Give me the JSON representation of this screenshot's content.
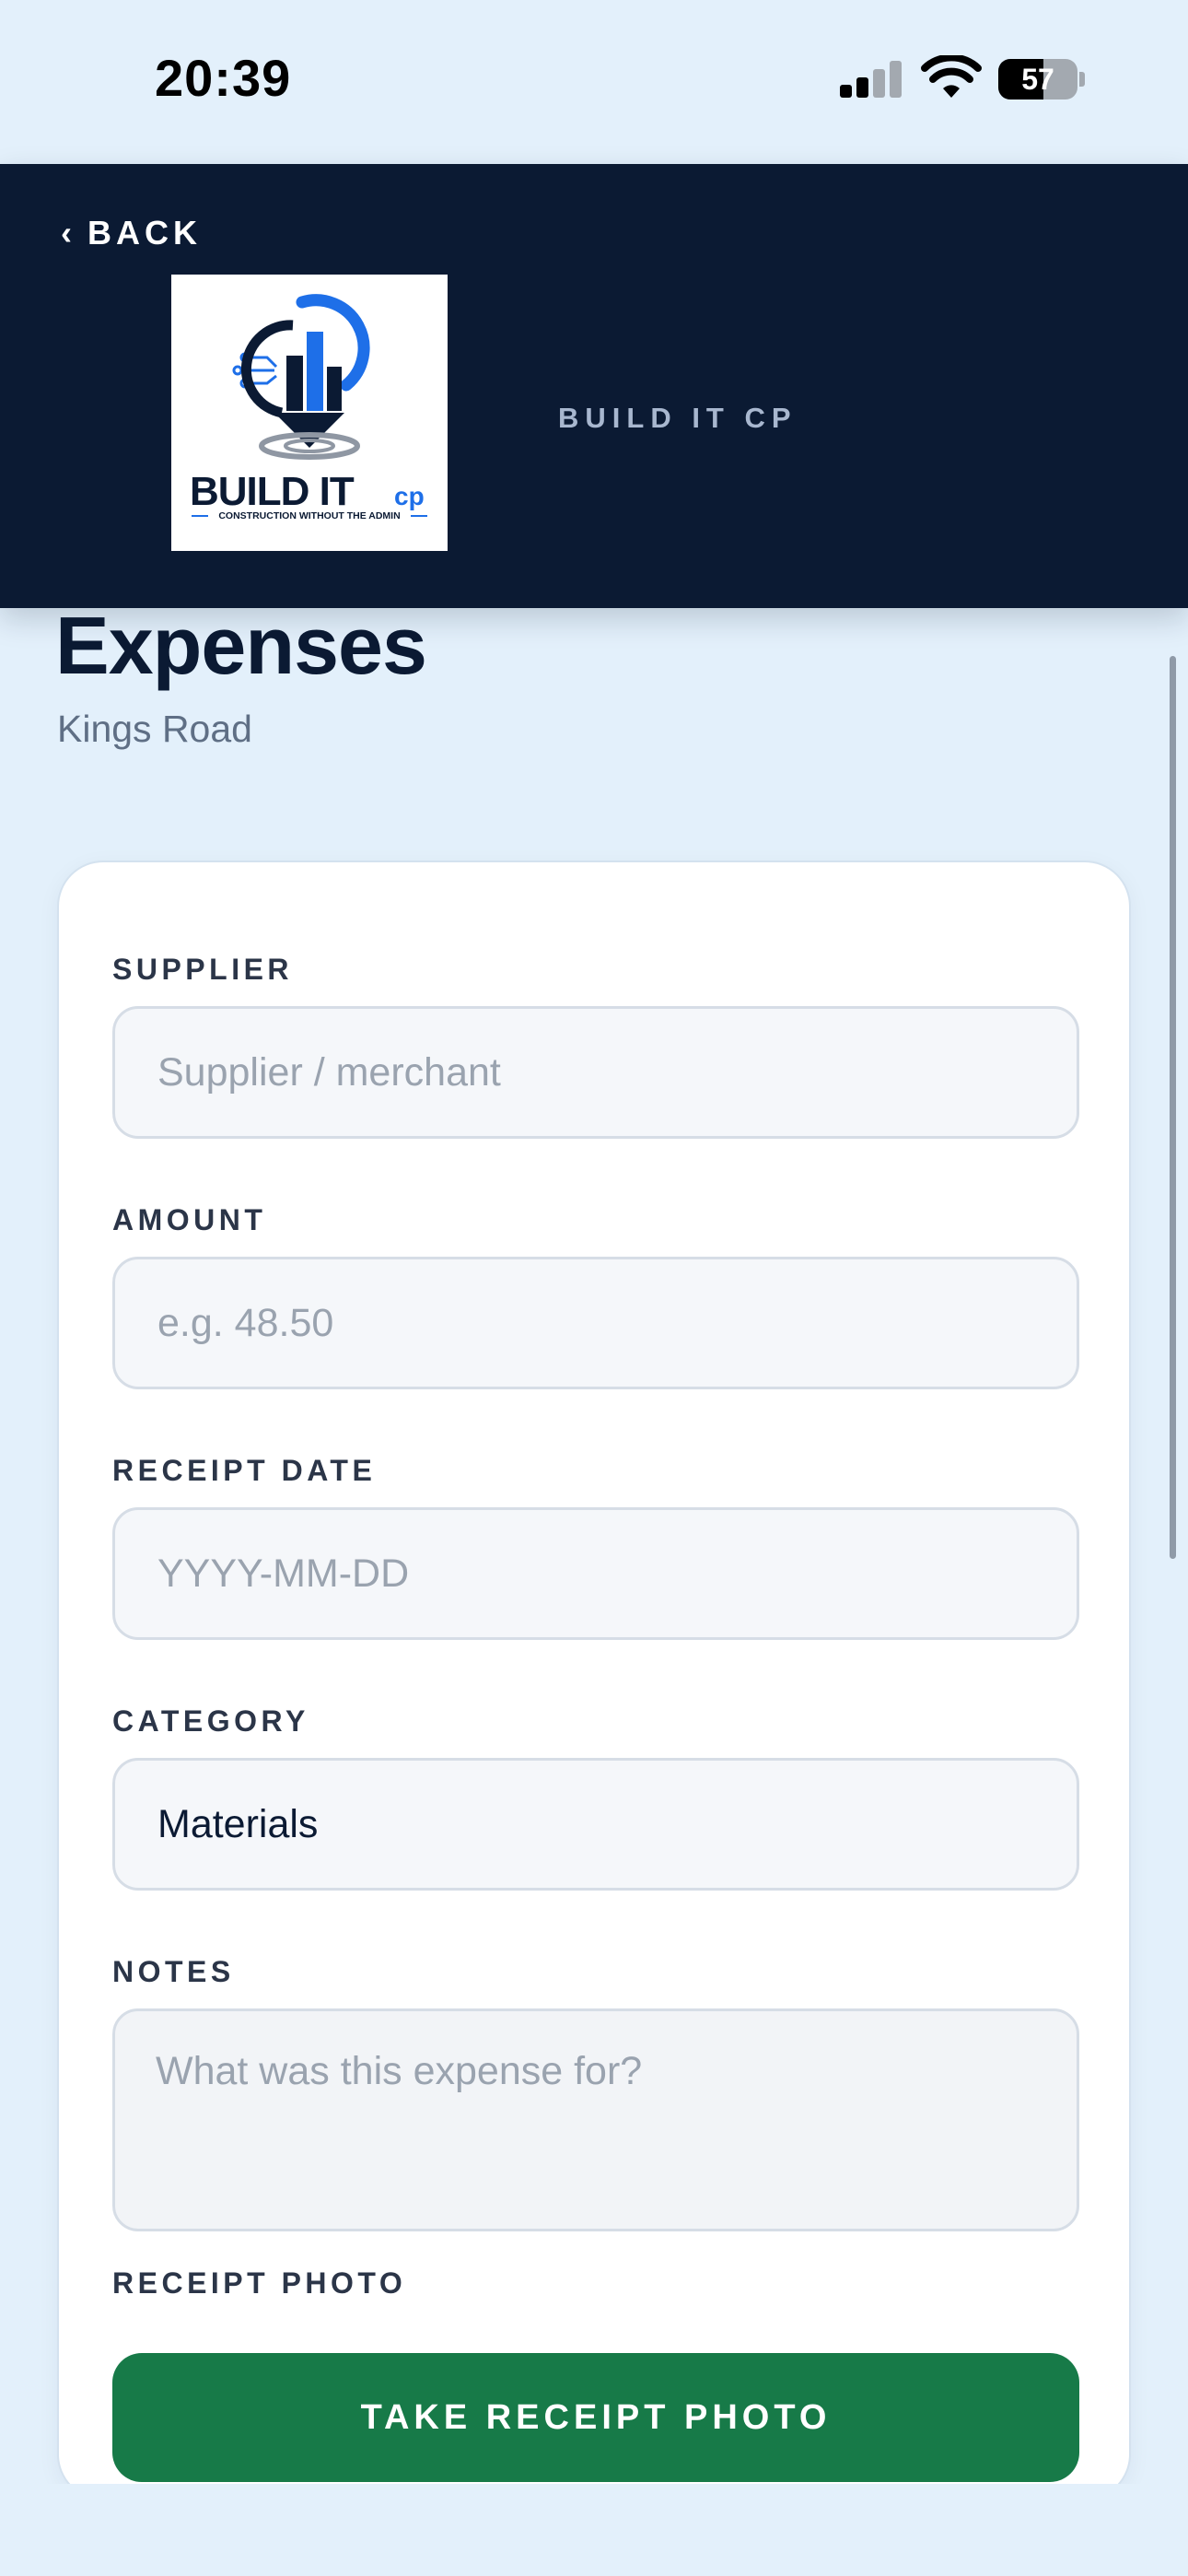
{
  "status_bar": {
    "time": "20:39",
    "battery_level": "57",
    "battery_fraction": 0.57
  },
  "header": {
    "back_label": "BACK",
    "back_chevron": "‹",
    "brand": "BUILD IT CP",
    "logo": {
      "wordmark": "BUILD IT",
      "suffix": "cp",
      "tagline": "CONSTRUCTION WITHOUT THE ADMIN"
    }
  },
  "page": {
    "title": "Expenses",
    "subtitle": "Kings Road"
  },
  "form": {
    "supplier": {
      "label": "SUPPLIER",
      "placeholder": "Supplier / merchant",
      "value": ""
    },
    "amount": {
      "label": "AMOUNT",
      "placeholder": "e.g. 48.50",
      "value": ""
    },
    "receipt_date": {
      "label": "RECEIPT DATE",
      "placeholder": "YYYY-MM-DD",
      "value": ""
    },
    "category": {
      "label": "CATEGORY",
      "value": "Materials"
    },
    "notes": {
      "label": "NOTES",
      "placeholder": "What was this expense for?",
      "value": ""
    },
    "receipt_photo": {
      "label": "RECEIPT PHOTO",
      "button_label": "TAKE RECEIPT PHOTO"
    }
  },
  "colors": {
    "page_bg": "#e3f0fb",
    "header_bg": "#0b1a33",
    "primary_button": "#177a48",
    "logo_blue": "#1e6fe8",
    "logo_navy": "#0b1a33"
  }
}
